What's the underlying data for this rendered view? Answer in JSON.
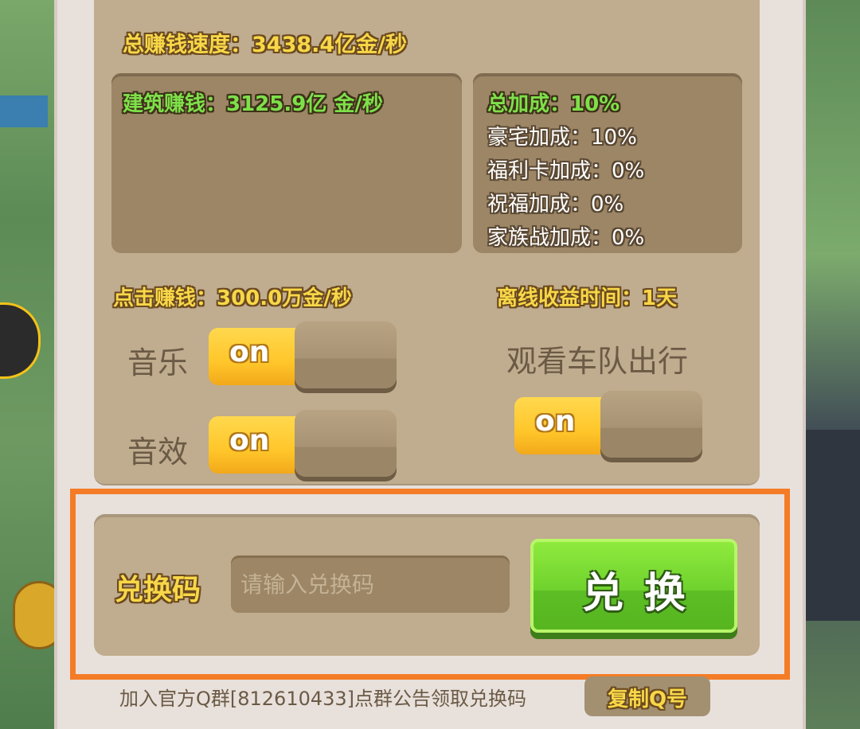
{
  "stats": {
    "total_speed": "总赚钱速度：3438.4亿金/秒",
    "building_income": "建筑赚钱：3125.9亿 金/秒",
    "bonuses": [
      {
        "label": "总加成：10%",
        "style": "green"
      },
      {
        "label": "豪宅加成：10%",
        "style": "white"
      },
      {
        "label": "福利卡加成：0%",
        "style": "white"
      },
      {
        "label": "祝福加成：0%",
        "style": "white"
      },
      {
        "label": "家族战加成：0%",
        "style": "white"
      }
    ],
    "click_income": "点击赚钱：300.0万金/秒",
    "offline_time": "离线收益时间：1天"
  },
  "settings": {
    "music_label": "音乐",
    "music_state": "on",
    "sfx_label": "音效",
    "sfx_state": "on",
    "fleet_label": "观看车队出行",
    "fleet_state": "on"
  },
  "redeem": {
    "label": "兑换码",
    "placeholder": "请输入兑换码",
    "value": "",
    "button_label": "兑换"
  },
  "footer": {
    "qq_note": "加入官方Q群[812610433]点群公告领取兑换码",
    "copy_button_label": "复制Q号"
  },
  "colors": {
    "highlight_frame": "#f47c26",
    "button_green": "#6fd22d",
    "toggle_on": "#ffc62a",
    "panel": "#c0ac8e"
  }
}
